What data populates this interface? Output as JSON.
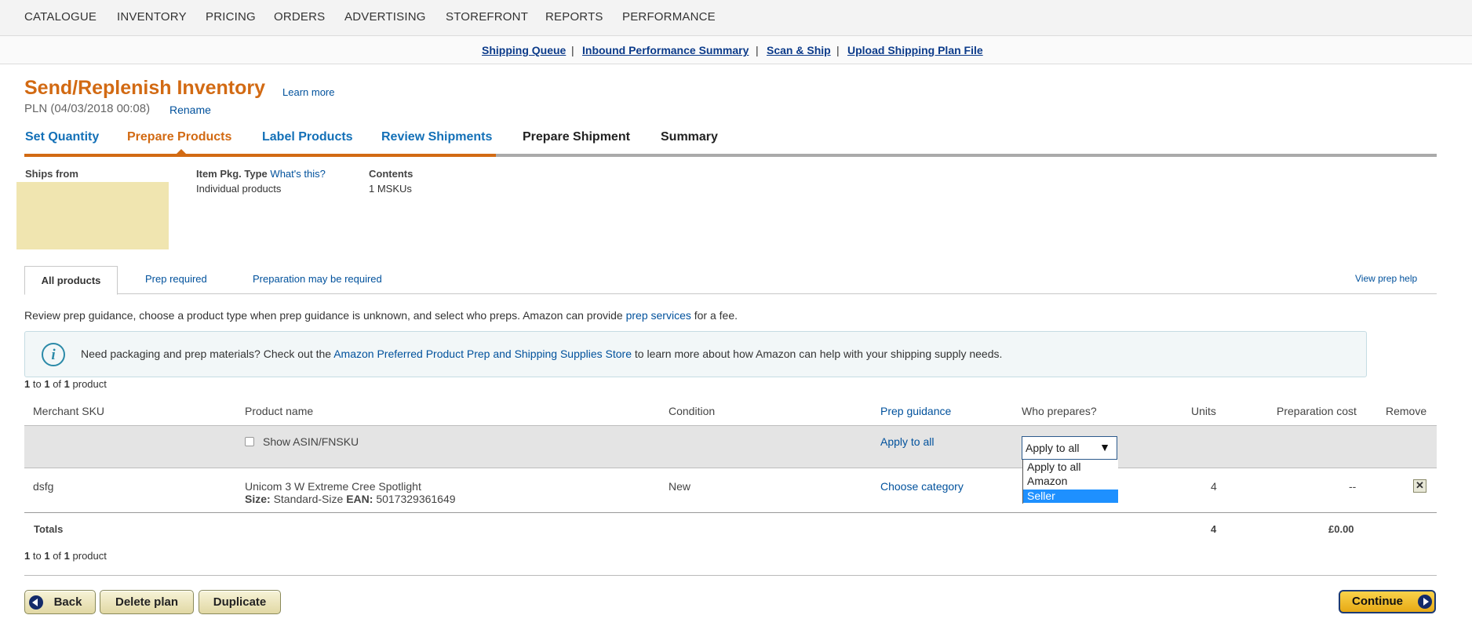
{
  "nav": {
    "items": [
      "CATALOGUE",
      "INVENTORY",
      "PRICING",
      "ORDERS",
      "ADVERTISING",
      "STOREFRONT",
      "REPORTS",
      "PERFORMANCE"
    ]
  },
  "subnav": {
    "links": [
      "Shipping Queue",
      "Inbound Performance Summary",
      "Scan & Ship",
      "Upload Shipping Plan File"
    ],
    "separator": "|"
  },
  "header": {
    "title": "Send/Replenish Inventory",
    "learn_more": "Learn more",
    "plan_name": "PLN (04/03/2018 00:08)",
    "rename": "Rename"
  },
  "steps": [
    {
      "label": "Set Quantity",
      "state": "done"
    },
    {
      "label": "Prepare Products",
      "state": "current"
    },
    {
      "label": "Label Products",
      "state": "done"
    },
    {
      "label": "Review Shipments",
      "state": "done"
    },
    {
      "label": "Prepare Shipment",
      "state": "todo"
    },
    {
      "label": "Summary",
      "state": "todo"
    }
  ],
  "plan_info": {
    "ships_from_label": "Ships from",
    "pkg_type_label": "Item Pkg. Type",
    "whats_this": "What's this?",
    "pkg_type_value": "Individual products",
    "contents_label": "Contents",
    "contents_value": "1 MSKUs"
  },
  "tabs": {
    "all": "All products",
    "prep_required": "Prep required",
    "prep_maybe": "Preparation may be required",
    "view_help": "View prep help"
  },
  "guidance": {
    "text_before": "Review prep guidance, choose a product type when prep guidance is unknown, and select who preps. Amazon can provide ",
    "link": "prep services",
    "text_after": " for a fee."
  },
  "info_box": {
    "text_before": "Need packaging and prep materials? Check out the ",
    "link": "Amazon Preferred Product Prep and Shipping Supplies Store",
    "text_after": " to learn more about how Amazon can help with your shipping supply needs."
  },
  "pager": {
    "from": "1",
    "to_word": "to",
    "to": "1",
    "of_word": "of",
    "total": "1",
    "unit": "product"
  },
  "table": {
    "columns": [
      "Merchant SKU",
      "Product name",
      "Condition",
      "Prep guidance",
      "Who prepares?",
      "Units",
      "Preparation cost",
      "Remove"
    ],
    "apply_row": {
      "show_asin": "Show ASIN/FNSKU",
      "apply_to_all": "Apply to all",
      "select_value": "Apply to all",
      "options": [
        "Apply to all",
        "Amazon",
        "Seller"
      ],
      "highlighted_option": "Seller"
    },
    "rows": [
      {
        "sku": "dsfg",
        "product_name": "Unicom 3 W Extreme Cree Spotlight",
        "size_label": "Size:",
        "size_value": "Standard-Size",
        "ean_label": "EAN:",
        "ean_value": "5017329361649",
        "condition": "New",
        "prep_guidance": "Choose category",
        "units": "4",
        "prep_cost": "--",
        "remove_icon": "✕"
      }
    ],
    "totals": {
      "label": "Totals",
      "units": "4",
      "cost": "£0.00"
    }
  },
  "buttons": {
    "back": "Back",
    "delete": "Delete plan",
    "duplicate": "Duplicate",
    "continue": "Continue"
  },
  "colors": {
    "title_orange": "#d26a13",
    "link_blue": "#00519c",
    "step_blue": "#1370b7",
    "highlight": "#1e90ff",
    "continue_gold": "#f0bf2a"
  }
}
